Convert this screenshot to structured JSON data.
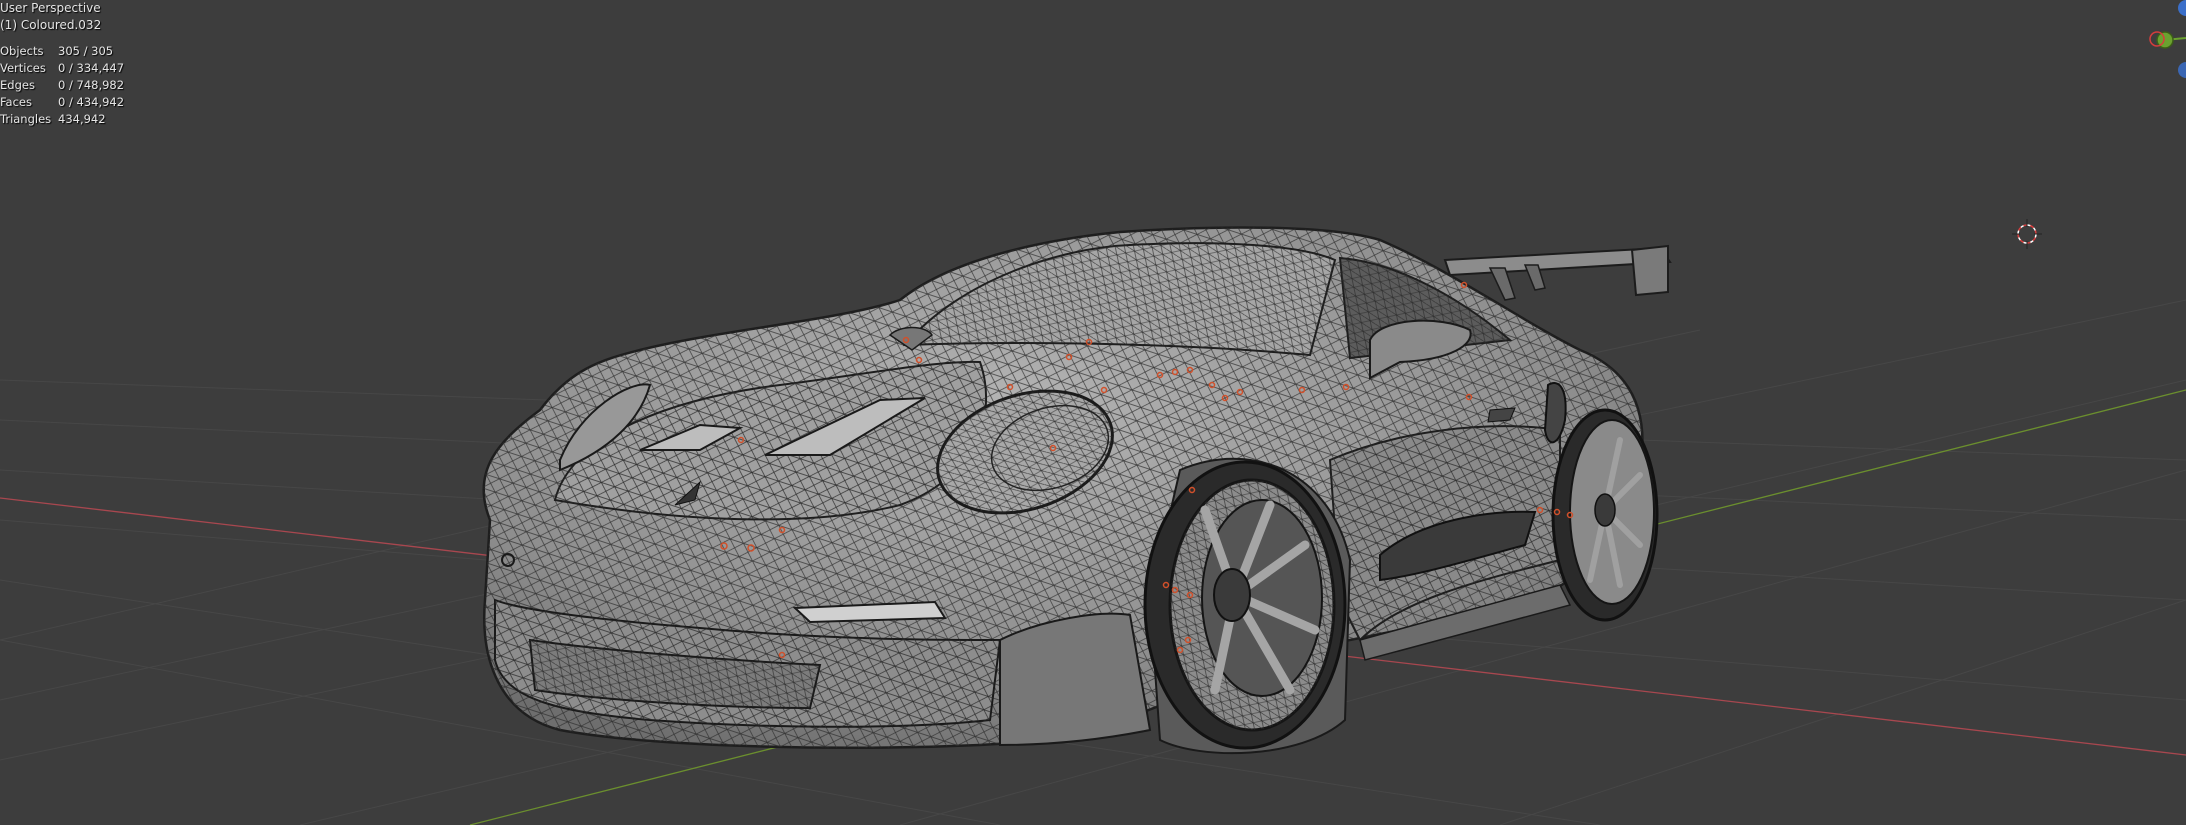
{
  "viewport": {
    "perspective_label": "User Perspective",
    "object_label": "(1) Coloured.032"
  },
  "stats": [
    {
      "label": "Objects",
      "value": "305 / 305"
    },
    {
      "label": "Vertices",
      "value": "0 / 334,447"
    },
    {
      "label": "Edges",
      "value": "0 / 748,982"
    },
    {
      "label": "Faces",
      "value": "0 / 434,942"
    },
    {
      "label": "Triangles",
      "value": "434,942"
    }
  ],
  "colors": {
    "background": "#3d3d3d",
    "grid": "#4a4a4a",
    "x_axis": "#a8474f",
    "y_axis": "#6b8f2e",
    "body": "#9a9a9a",
    "wire": "#2a2a2a",
    "gizmo_green": "#6ba22f",
    "gizmo_blue": "#3b6fc9",
    "gizmo_red": "#d63d3d",
    "markers": "#d2502a",
    "text": "#e6e6e6"
  },
  "icons": {
    "navigation_gizmo": "axis-gizmo-icon",
    "cursor": "3d-cursor-icon"
  }
}
